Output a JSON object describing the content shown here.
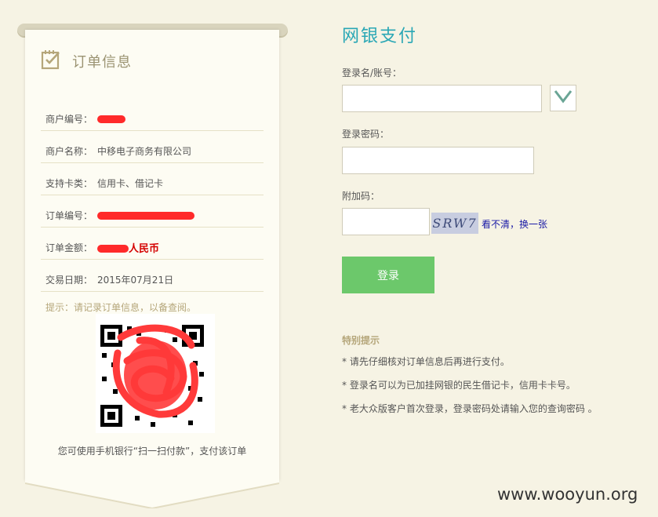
{
  "order_panel": {
    "title": "订单信息",
    "rows": [
      {
        "label": "商户编号：",
        "value": ""
      },
      {
        "label": "商户名称：",
        "value": "中移电子商务有限公司"
      },
      {
        "label": "支持卡类：",
        "value": "信用卡、借记卡"
      },
      {
        "label": "订单编号：",
        "value": ""
      },
      {
        "label": "订单金额：",
        "value": "人民币"
      },
      {
        "label": "交易日期：",
        "value": "2015年07月21日"
      }
    ],
    "tip": "提示：请记录订单信息，以备查阅。",
    "qr_caption": "您可使用手机银行“扫一扫付款”，支付该订单"
  },
  "login_form": {
    "title": "网银支付",
    "username_label": "登录名/账号：",
    "password_label": "登录密码：",
    "captcha_label": "附加码：",
    "captcha_text": "SRW7",
    "captcha_refresh": "看不清，换一张",
    "submit_label": "登录"
  },
  "notes": {
    "title": "特别提示",
    "items": [
      "* 请先仔细核对订单信息后再进行支付。",
      "* 登录名可以为已加挂网银的民生借记卡，信用卡卡号。",
      "* 老大众版客户首次登录，登录密码处请输入您的查询密码 。"
    ]
  },
  "watermark": "www.wooyun.org",
  "colors": {
    "accent_teal": "#2aa7b5",
    "button_green": "#6cc86b",
    "amount_red": "#d40000",
    "background": "#f6f3e4"
  }
}
